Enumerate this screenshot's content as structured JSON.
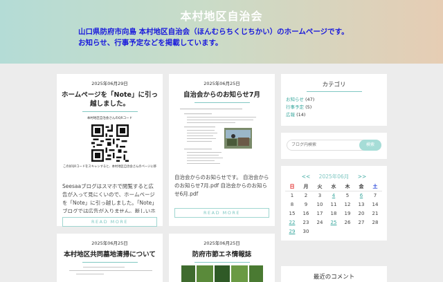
{
  "header": {
    "site_title": "本村地区自治会",
    "description_line1": "山口県防府市向島 本村地区自治会（ほんむらちくじちかい）のホームページです。",
    "description_line2": "お知らせ、行事予定などを掲載しています。"
  },
  "posts": [
    {
      "date": "2025年06月29日",
      "title": "ホームページを「Note」に引っ越しました。",
      "thumb_caption": "本村地区自治会さんのQRコード",
      "thumb_footer": "この好QRコードをスキャンすると、本村地区自治会さんのページに移",
      "excerpt": "Seesaaブログはスマホで閲覧すると広告が入って見にくいので、ホームページを「Note」に引っ越しました。「Note」ブログでは広告が入りません。新しいホ",
      "read_more": "READ MORE"
    },
    {
      "date": "2025年06月25日",
      "title": "自治会からのお知らせ7月",
      "excerpt": "自治会からのお知らせです。 自治会からのお知らせ7月.pdf 自治会からのお知らせ6月.pdf",
      "read_more": "READ MORE"
    },
    {
      "date": "2025年06月25日",
      "title": "本村地区共同墓地清掃について"
    },
    {
      "date": "2025年06月25日",
      "title": "防府市節エネ情報誌"
    }
  ],
  "sidebar": {
    "category_title": "カテゴリ",
    "categories": [
      {
        "label": "お知らせ",
        "count": "(47)"
      },
      {
        "label": "行事予定",
        "count": "(5)"
      },
      {
        "label": "広報",
        "count": "(14)"
      }
    ],
    "search": {
      "placeholder": "ブログ内検索",
      "button": "検索"
    },
    "calendar": {
      "prev": "<<",
      "month": "2025年06月",
      "next": ">>",
      "weekdays": [
        "日",
        "月",
        "火",
        "水",
        "木",
        "金",
        "土"
      ],
      "weeks": [
        [
          "1",
          "2",
          "3",
          "4",
          "5",
          "6",
          "7"
        ],
        [
          "8",
          "9",
          "10",
          "11",
          "12",
          "13",
          "14"
        ],
        [
          "15",
          "16",
          "17",
          "18",
          "19",
          "20",
          "21"
        ],
        [
          "22",
          "23",
          "24",
          "25",
          "26",
          "27",
          "28"
        ],
        [
          "29",
          "30",
          "",
          "",
          "",
          "",
          ""
        ]
      ],
      "linked_days": [
        "4",
        "6",
        "22",
        "25",
        "29"
      ]
    },
    "recent_comments_title": "最近のコメント"
  },
  "colors": {
    "accent": "#7fc7c2",
    "link": "#3ba89f",
    "description": "#1a1adc",
    "sunday": "#e02020",
    "saturday": "#1a3ad8"
  }
}
